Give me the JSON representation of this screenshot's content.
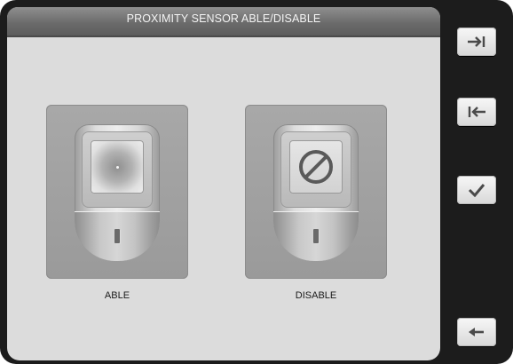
{
  "header": {
    "title": "PROXIMITY SENSOR ABLE/DISABLE"
  },
  "options": [
    {
      "label": "ABLE",
      "icon": "sensor-icon"
    },
    {
      "label": "DISABLE",
      "icon": "sensor-disabled-icon"
    }
  ],
  "sidebar": {
    "buttons": [
      {
        "icon": "arrow-to-right-icon"
      },
      {
        "icon": "arrow-to-left-icon"
      },
      {
        "icon": "check-icon"
      },
      {
        "icon": "back-arrow-icon"
      }
    ]
  },
  "colors": {
    "frame": "#1c1c1c",
    "panel": "#dcdcdc",
    "titlebar": "#6a6a6a",
    "tile": "#a3a3a3"
  }
}
